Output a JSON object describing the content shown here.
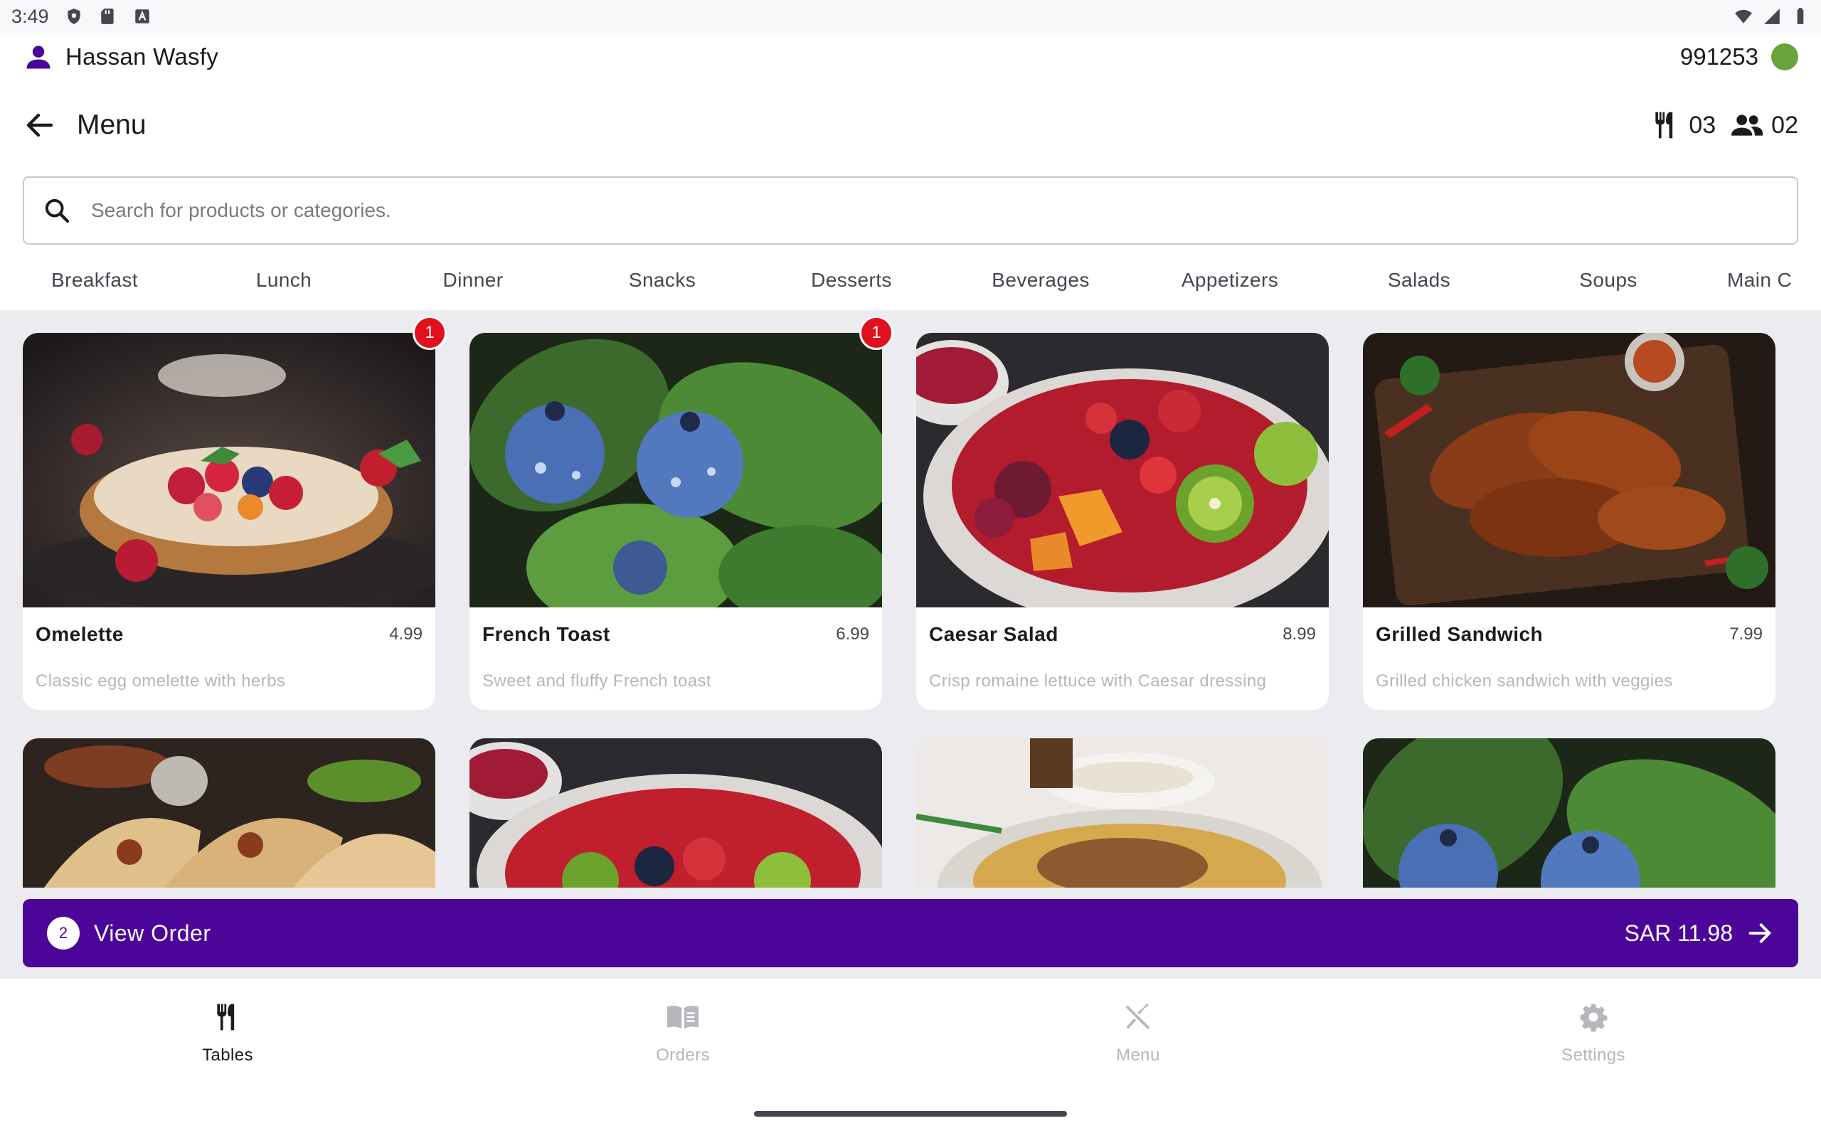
{
  "status_bar": {
    "time": "3:49"
  },
  "header": {
    "user_name": "Hassan Wasfy",
    "device_id": "991253",
    "screen_title": "Menu",
    "table_count": "03",
    "guest_count": "02"
  },
  "search": {
    "placeholder": "Search for products or categories."
  },
  "categories": [
    "Breakfast",
    "Lunch",
    "Dinner",
    "Snacks",
    "Desserts",
    "Beverages",
    "Appetizers",
    "Salads",
    "Soups",
    "Main C"
  ],
  "products": [
    {
      "name": "Omelette",
      "price": "4.99",
      "description": "Classic egg omelette with herbs",
      "badge": "1"
    },
    {
      "name": "French Toast",
      "price": "6.99",
      "description": "Sweet and fluffy French toast",
      "badge": "1"
    },
    {
      "name": "Caesar Salad",
      "price": "8.99",
      "description": "Crisp romaine lettuce with Caesar dressing"
    },
    {
      "name": "Grilled Sandwich",
      "price": "7.99",
      "description": "Grilled chicken sandwich with veggies"
    }
  ],
  "order_bar": {
    "count": "2",
    "label": "View Order",
    "total": "SAR 11.98"
  },
  "bottom_nav": [
    {
      "label": "Tables",
      "icon": "utensils-icon",
      "active": true
    },
    {
      "label": "Orders",
      "icon": "book-icon"
    },
    {
      "label": "Menu",
      "icon": "crossed-utensils-icon"
    },
    {
      "label": "Settings",
      "icon": "gear-icon"
    }
  ],
  "colors": {
    "primary": "#4C0599",
    "online": "#6AA33B",
    "badge": "#E0101C"
  }
}
